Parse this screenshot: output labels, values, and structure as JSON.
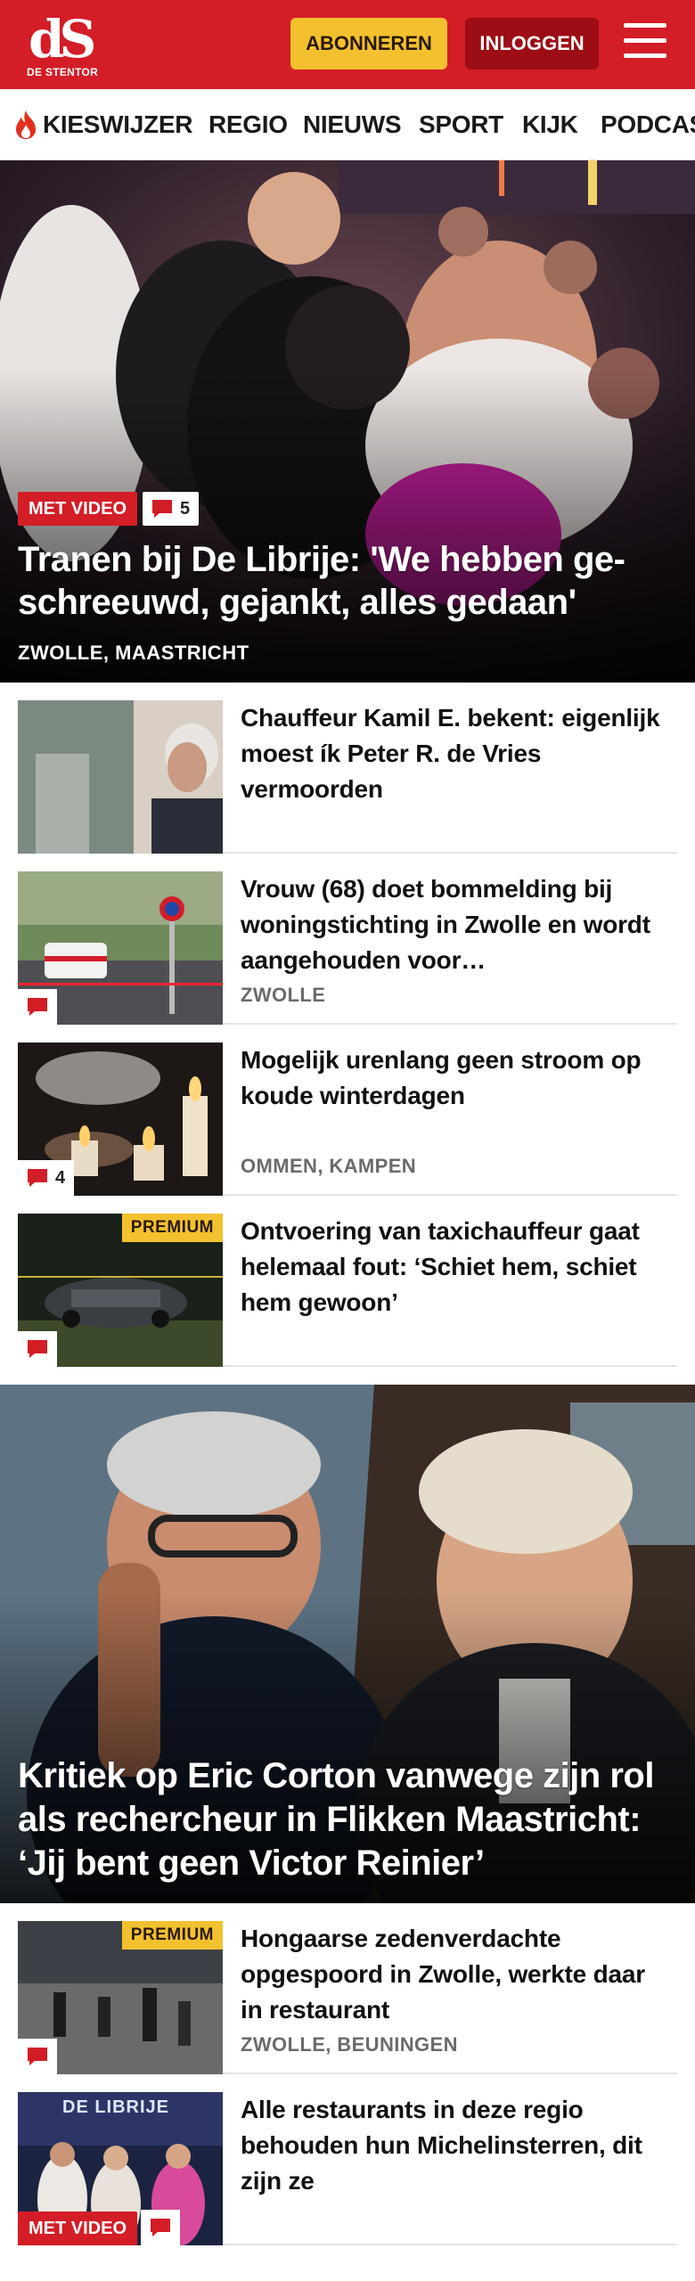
{
  "header": {
    "logo_mark": "dS",
    "logo_sub": "DE STENTOR",
    "subscribe_label": "ABONNEREN",
    "login_label": "INLOGGEN"
  },
  "nav": {
    "items": [
      "KIESWIJZER",
      "REGIO",
      "NIEUWS",
      "SPORT",
      "KIJK",
      "PODCAST"
    ]
  },
  "hero1": {
    "badge_video": "MET VIDEO",
    "comment_count": "5",
    "title": "Tranen bij De Librije: 'We hebben ge-schreeuwd, gejankt, alles gedaan'",
    "location": "ZWOLLE, MAASTRICHT"
  },
  "articles": [
    {
      "title": "Chauffeur Kamil E. bekent: eigenlijk moest ík Peter R. de Vries vermoorden",
      "location": ""
    },
    {
      "title": "Vrouw (68) doet bommelding bij woningstichting in Zwolle en wordt aangehouden voor…",
      "location": "ZWOLLE"
    },
    {
      "title": "Mogelijk urenlang geen stroom op koude winterdagen",
      "location": "OMMEN, KAMPEN",
      "comment_count": "4"
    },
    {
      "title": "Ontvoering van taxichauffeur gaat helemaal fout: ‘Schiet hem, schiet hem gewoon’",
      "location": "",
      "premium": "PREMIUM"
    }
  ],
  "hero2": {
    "title": "Kritiek op Eric Corton vanwege zijn rol als rechercheur in Flikken Maastricht: ‘Jij bent geen Victor Reinier’"
  },
  "articles2": [
    {
      "title": "Hongaarse zedenverdachte opgespoord in Zwolle, werkte daar in restaurant",
      "location": "ZWOLLE, BEUNINGEN",
      "premium": "PREMIUM"
    },
    {
      "title": "Alle restaurants in deze regio behouden hun Michelinsterren, dit zijn ze",
      "location": "",
      "badge_video": "MET VIDEO",
      "thumb_text": "DE LIBRIJE"
    }
  ],
  "colors": {
    "brand_red": "#d31d27",
    "premium_yellow": "#f3c12f",
    "login_dark_red": "#9c0d15"
  },
  "icons": [
    "hamburger-menu-icon",
    "flame-icon",
    "comment-bubble-icon"
  ]
}
